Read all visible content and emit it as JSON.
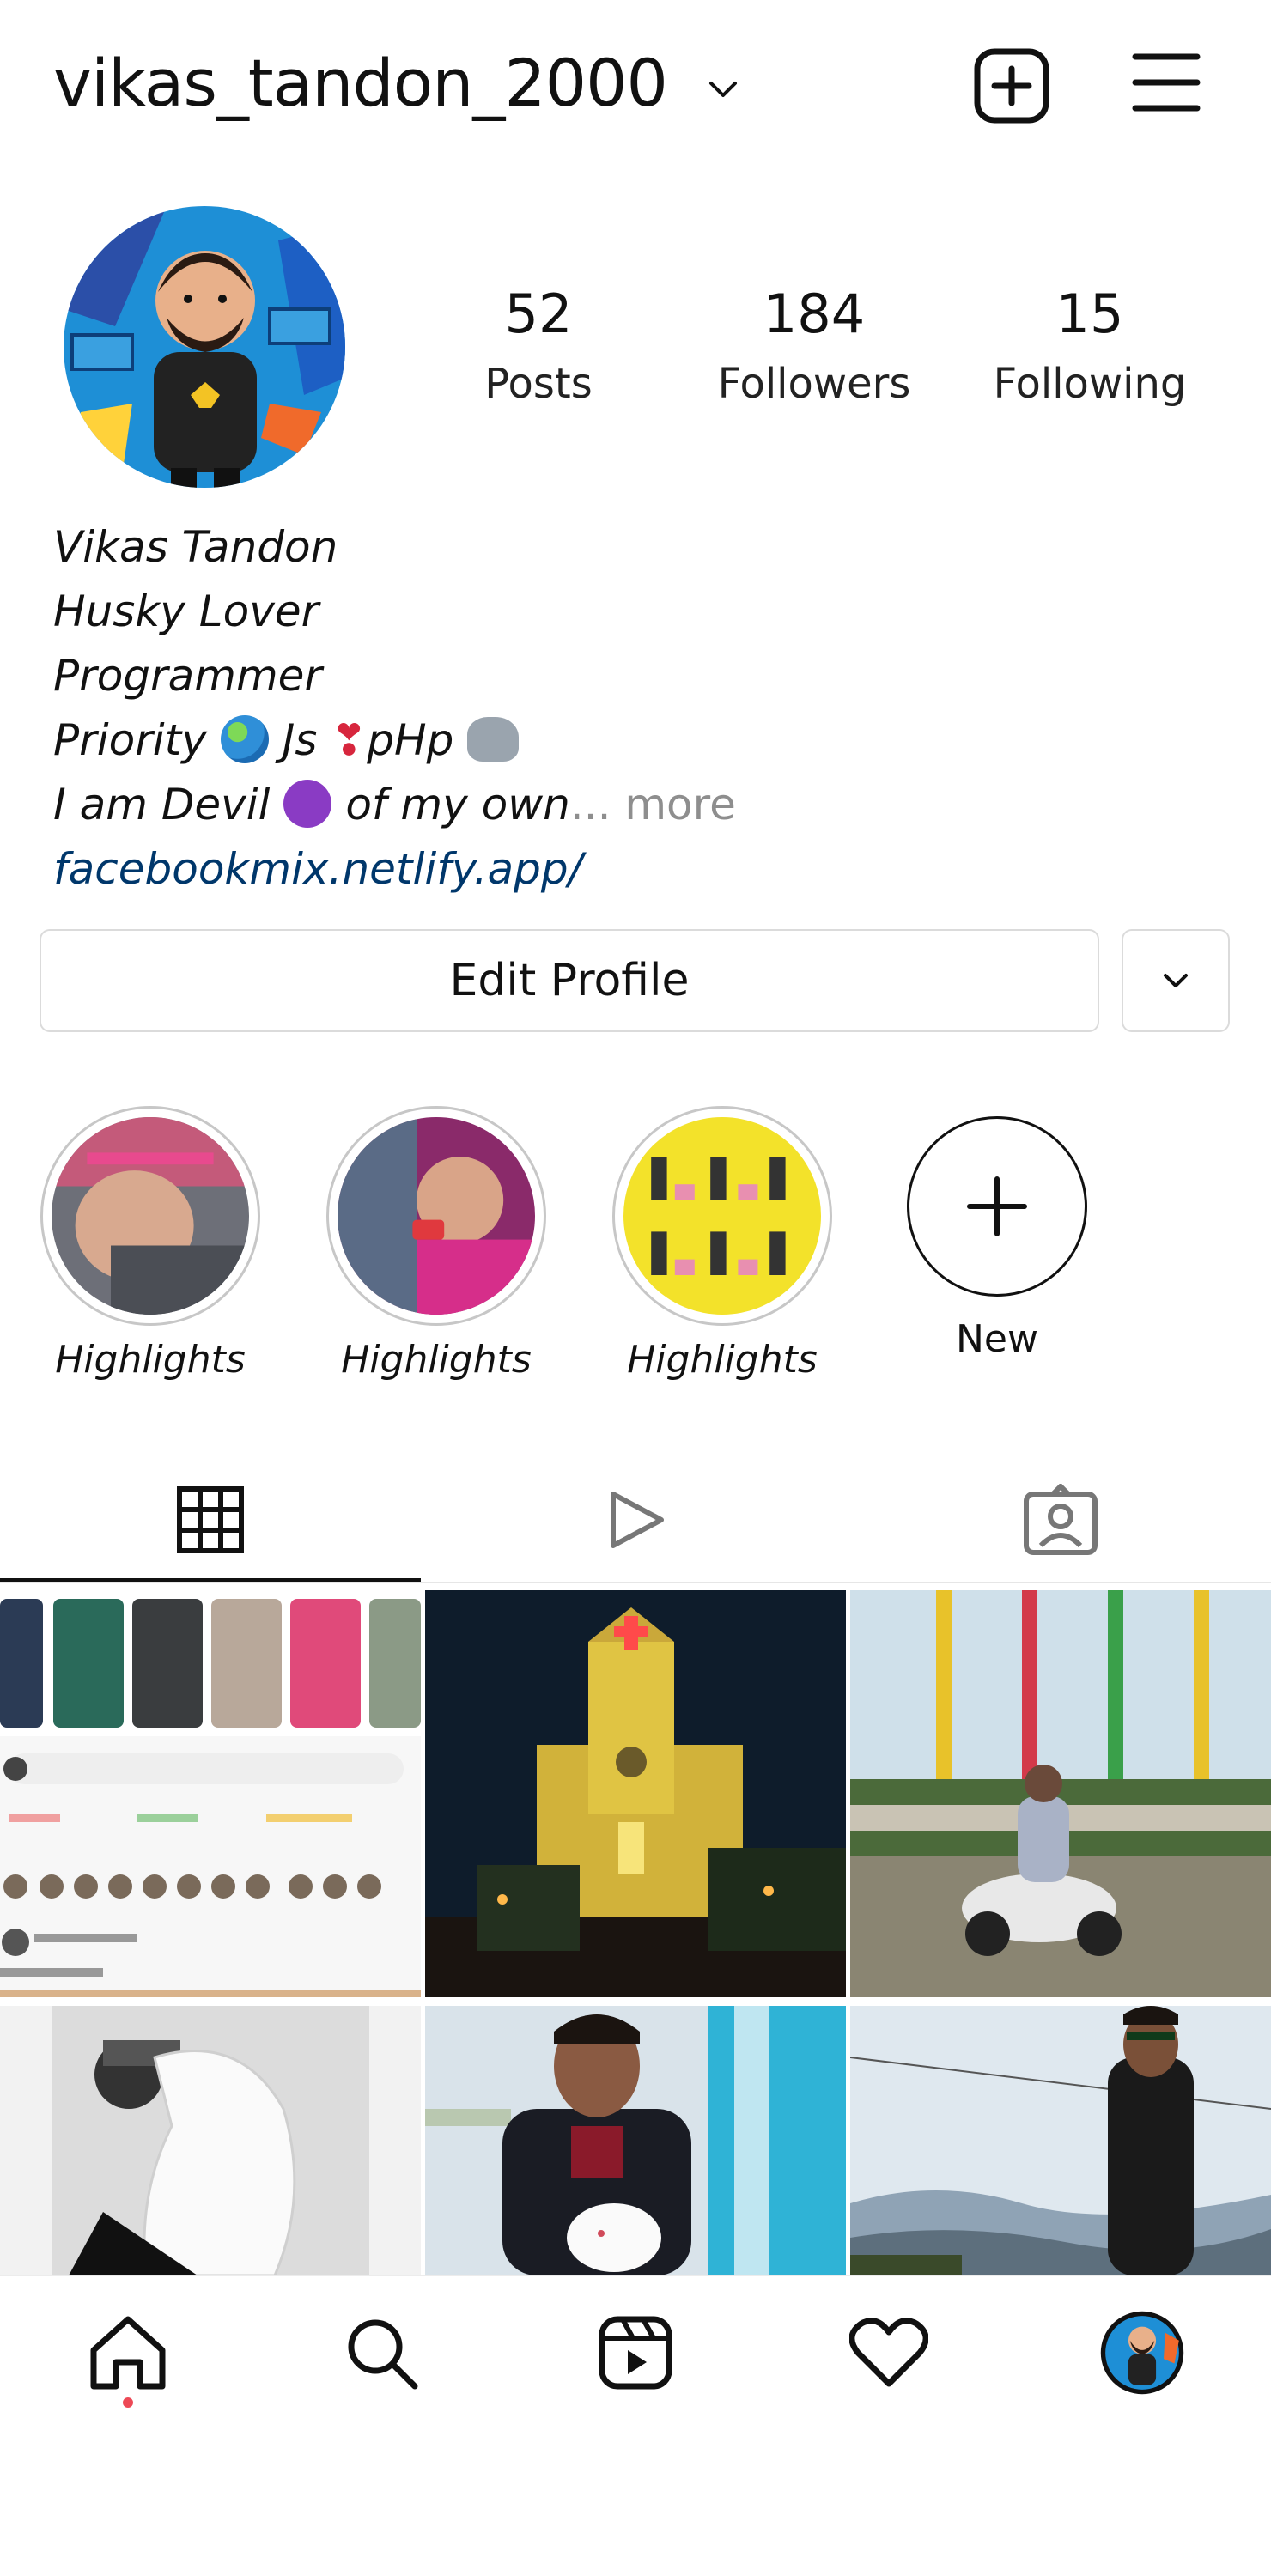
{
  "header": {
    "username": "vikas_tandon_2000",
    "icons": [
      "chevron-down-icon",
      "new-post-icon",
      "menu-icon"
    ]
  },
  "stats": [
    {
      "value": "52",
      "label": "Posts"
    },
    {
      "value": "184",
      "label": "Followers"
    },
    {
      "value": "15",
      "label": "Following"
    }
  ],
  "bio": {
    "name": "Vikas Tandon",
    "line1": "Husky Lover",
    "line2": "Programmer",
    "line3_a": "Priority",
    "line3_b": "Js",
    "line3_c": "pHp",
    "line4_a": "I am Devil",
    "line4_b": "of my own",
    "more": "... more",
    "link": "facebookmix.netlify.app/"
  },
  "actions": {
    "edit_profile": "Edit Profile"
  },
  "highlights": [
    {
      "label": "Highlights"
    },
    {
      "label": "Highlights"
    },
    {
      "label": "Highlights"
    },
    {
      "label": "New"
    }
  ],
  "tabs": [
    "grid-icon",
    "reels-icon",
    "tagged-icon"
  ],
  "colors": {
    "link": "#00376b",
    "more": "#8e8e8e",
    "notification_dot": "#ed4956",
    "border": "#dbdbdb"
  },
  "bottom_nav": [
    "home-icon",
    "search-icon",
    "reels-icon",
    "heart-icon",
    "profile-avatar"
  ]
}
